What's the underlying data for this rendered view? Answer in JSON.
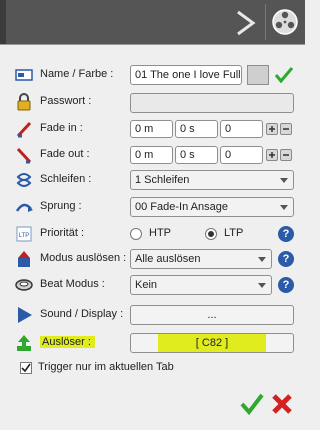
{
  "colors": {
    "check": "#2ea82e",
    "cancel": "#d42020",
    "highlight": "#e1ec1e",
    "help": "#2a5aa8"
  },
  "header": {
    "arrow_icon": "chevron-right-icon",
    "reel_icon": "film-reel-icon"
  },
  "name_farbe": {
    "label": "Name / Farbe :",
    "value": "01 The one I love Full",
    "confirm_icon": "check-icon"
  },
  "passwort": {
    "label": "Passwort :",
    "value": ""
  },
  "fade_in": {
    "label": "Fade in :",
    "m": "0 m",
    "s": "0 s",
    "ms": "0"
  },
  "fade_out": {
    "label": "Fade out :",
    "m": "0 m",
    "s": "0 s",
    "ms": "0"
  },
  "schleifen": {
    "label": "Schleifen :",
    "value": "1 Schleifen"
  },
  "sprung": {
    "label": "Sprung :",
    "value": "00 Fade-In Ansage"
  },
  "prioritaet": {
    "label": "Priorität :",
    "options": [
      "HTP",
      "LTP"
    ],
    "selected": "LTP",
    "help": "?"
  },
  "modus_ausloesen": {
    "label": "Modus auslösen :",
    "value": "Alle auslösen",
    "help": "?"
  },
  "beat_modus": {
    "label": "Beat Modus :",
    "value": "Kein",
    "help": "?"
  },
  "sound_display": {
    "label": "Sound / Display :",
    "button": "..."
  },
  "ausloeser": {
    "label": "Auslöser :",
    "button": "[ C82 ]"
  },
  "trigger": {
    "label": "Trigger nur im aktuellen Tab",
    "checked": true
  }
}
